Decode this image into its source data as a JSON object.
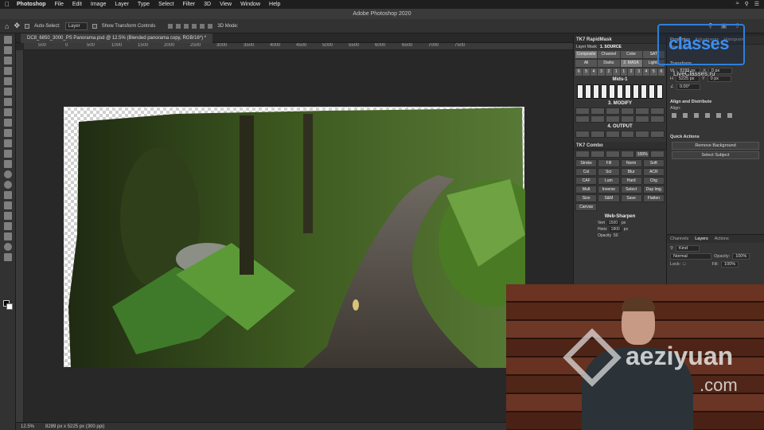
{
  "menubar": {
    "app": "Photoshop",
    "items": [
      "File",
      "Edit",
      "Image",
      "Layer",
      "Type",
      "Select",
      "Filter",
      "3D",
      "View",
      "Window",
      "Help"
    ]
  },
  "window": {
    "title": "Adobe Photoshop 2020"
  },
  "options": {
    "auto_select_label": "Auto-Select:",
    "auto_select_value": "Layer",
    "transform_label": "Show Transform Controls",
    "mode_3d": "3D Mode:"
  },
  "document": {
    "tab_title": "DC8_6850_3000_PS Panorama.psd @ 12.5% (Blended panorama copy, RGB/16*) *",
    "ruler_ticks": [
      "500",
      "0",
      "500",
      "1000",
      "1500",
      "2000",
      "2500",
      "3000",
      "3500",
      "4000",
      "4500",
      "5000",
      "5500",
      "6000",
      "6500",
      "7000",
      "7500"
    ]
  },
  "status": {
    "zoom": "12.5%",
    "dims": "8289 px x 5225 px (300 ppi)"
  },
  "tk7": {
    "title": "TK7 RapidMask",
    "layer_mask": "Layer Mask",
    "source_heading": "1. SOURCE",
    "source_tabs": [
      "Composite",
      "Channel",
      "Color",
      "SAT"
    ],
    "mask_tabs": [
      "All",
      "Darks",
      "2. MASK",
      "Lights"
    ],
    "nums": [
      "6",
      "5",
      "4",
      "3",
      "2",
      "1",
      "1",
      "2",
      "3",
      "4",
      "5",
      "6"
    ],
    "mids": "Mids-1",
    "modify_heading": "3. MODIFY",
    "output_heading": "4. OUTPUT",
    "combo_title": "TK7 Combo",
    "combo_pct": "100%",
    "combo_buttons": [
      "Stroke",
      "Fill",
      "Norm",
      "Soft",
      "Col",
      "Scr",
      "Blur",
      "ACR",
      "CAF",
      "Lum",
      "Hard",
      "Chg",
      "Mult",
      "Inverse",
      "Select",
      "Dup Img",
      "Size",
      "S&M",
      "Save",
      "Flatten",
      "Canvas"
    ],
    "web_sharpen": "Web-Sharpen",
    "vert_label": "Vert",
    "vert_value": "1500",
    "horiz_label": "Horiz",
    "horiz_value": "1800",
    "unit": "px",
    "opacity_label": "Opacity",
    "opacity_value": "50"
  },
  "properties": {
    "tabs": [
      "Properties",
      "Adjustments",
      "Histogram"
    ],
    "layer_type": "Pixel Layer",
    "transform_heading": "Transform",
    "w_label": "W",
    "w_value": "8289 px",
    "h_label": "H",
    "h_value": "5225 px",
    "x_label": "X",
    "x_value": "0 px",
    "y_label": "Y",
    "y_value": "0 px",
    "angle": "0.00°",
    "align_heading": "Align and Distribute",
    "align_sub": "Align:",
    "quick_heading": "Quick Actions",
    "remove_bg": "Remove Background",
    "select_subject": "Select Subject"
  },
  "layers": {
    "tabs": [
      "Channels",
      "Layers",
      "Actions"
    ],
    "kind": "Kind",
    "blend": "Normal",
    "opacity_label": "Opacity:",
    "opacity_value": "100%",
    "lock_label": "Lock:",
    "fill_label": "Fill:",
    "fill_value": "100%"
  },
  "watermarks": {
    "classes_big": "classes",
    "classes_small": "LiveClasses.ru",
    "aezi": "aeziyuan",
    "aezi_com": ".com"
  }
}
